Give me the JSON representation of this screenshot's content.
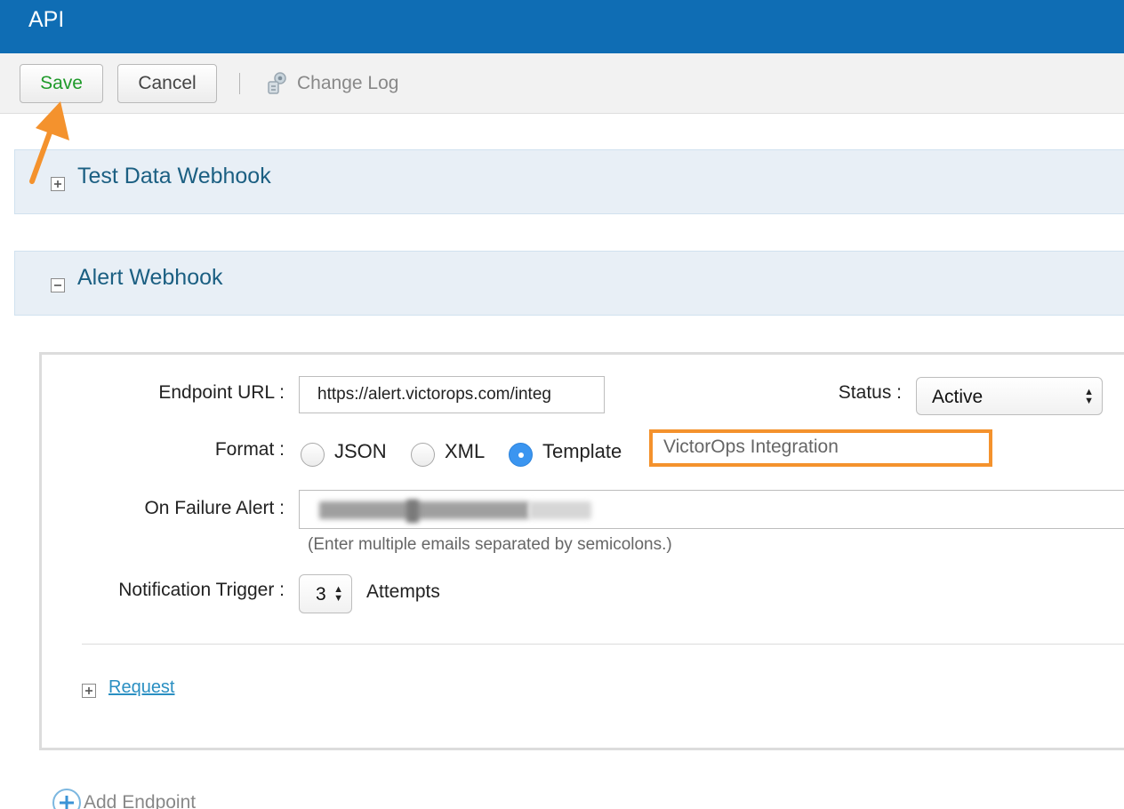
{
  "header": {
    "title": "API"
  },
  "toolbar": {
    "save_label": "Save",
    "cancel_label": "Cancel",
    "changelog_label": "Change Log"
  },
  "sections": [
    {
      "title": "Test Data Webhook",
      "expanded": false
    },
    {
      "title": "Alert Webhook",
      "expanded": true
    }
  ],
  "form": {
    "endpoint_label": "Endpoint URL :",
    "endpoint_value": "https://alert.victorops.com/integ",
    "status_label": "Status :",
    "status_value": "Active",
    "format_label": "Format :",
    "format_options": [
      "JSON",
      "XML",
      "Template"
    ],
    "format_selected": "Template",
    "template_value": "VictorOps Integration",
    "failure_label": "On Failure Alert :",
    "failure_hint": "(Enter multiple emails separated by semicolons.)",
    "trigger_label": "Notification Trigger :",
    "trigger_value": "3",
    "trigger_suffix": "Attempts"
  },
  "request_label": "Request",
  "add_endpoint_label": "Add Endpoint",
  "colors": {
    "header_bg": "#0f6db4",
    "save_text": "#1f9a2a",
    "section_bg": "#e8eff6",
    "highlight": "#f4922d",
    "radio_selected": "#3b95f0"
  },
  "icons": [
    "changelog-icon",
    "expand-plus-icon",
    "collapse-minus-icon",
    "add-circle-icon",
    "annotation-arrow-icon"
  ]
}
